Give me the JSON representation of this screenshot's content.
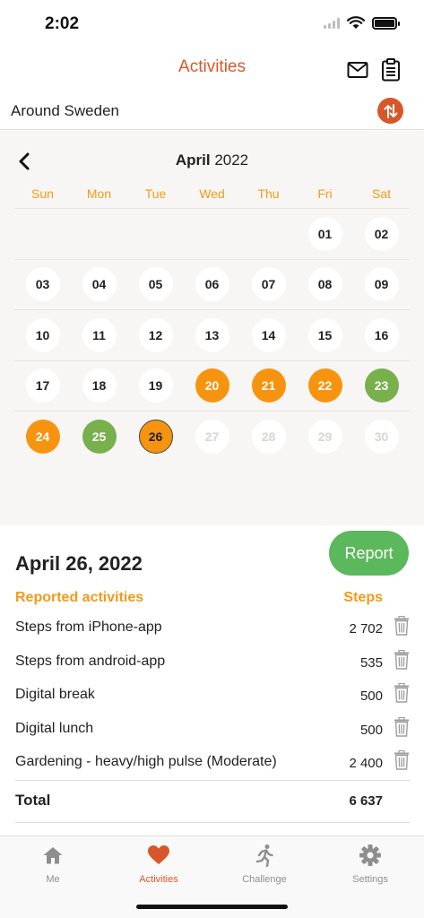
{
  "status": {
    "time": "2:02"
  },
  "nav": {
    "title": "Activities"
  },
  "team": {
    "name": "Around Sweden"
  },
  "calendar": {
    "month": "April",
    "year": "2022",
    "weekdays": [
      "Sun",
      "Mon",
      "Tue",
      "Wed",
      "Thu",
      "Fri",
      "Sat"
    ],
    "weeks": [
      [
        null,
        null,
        null,
        null,
        null,
        {
          "d": "01",
          "s": "plain"
        },
        {
          "d": "02",
          "s": "plain"
        }
      ],
      [
        {
          "d": "03",
          "s": "plain"
        },
        {
          "d": "04",
          "s": "plain"
        },
        {
          "d": "05",
          "s": "plain"
        },
        {
          "d": "06",
          "s": "plain"
        },
        {
          "d": "07",
          "s": "plain"
        },
        {
          "d": "08",
          "s": "plain"
        },
        {
          "d": "09",
          "s": "plain"
        }
      ],
      [
        {
          "d": "10",
          "s": "plain"
        },
        {
          "d": "11",
          "s": "plain"
        },
        {
          "d": "12",
          "s": "plain"
        },
        {
          "d": "13",
          "s": "plain"
        },
        {
          "d": "14",
          "s": "plain"
        },
        {
          "d": "15",
          "s": "plain"
        },
        {
          "d": "16",
          "s": "plain"
        }
      ],
      [
        {
          "d": "17",
          "s": "plain"
        },
        {
          "d": "18",
          "s": "plain"
        },
        {
          "d": "19",
          "s": "plain"
        },
        {
          "d": "20",
          "s": "orange"
        },
        {
          "d": "21",
          "s": "orange"
        },
        {
          "d": "22",
          "s": "orange"
        },
        {
          "d": "23",
          "s": "green"
        }
      ],
      [
        {
          "d": "24",
          "s": "orange"
        },
        {
          "d": "25",
          "s": "green"
        },
        {
          "d": "26",
          "s": "today"
        },
        {
          "d": "27",
          "s": "future"
        },
        {
          "d": "28",
          "s": "future"
        },
        {
          "d": "29",
          "s": "future"
        },
        {
          "d": "30",
          "s": "future"
        }
      ]
    ]
  },
  "detail": {
    "date": "April 26, 2022",
    "report_label": "Report",
    "list_header_left": "Reported activities",
    "list_header_right": "Steps",
    "activities": [
      {
        "name": "Steps from iPhone-app",
        "steps": "2 702"
      },
      {
        "name": "Steps from android-app",
        "steps": "535"
      },
      {
        "name": "Digital break",
        "steps": "500"
      },
      {
        "name": "Digital lunch",
        "steps": "500"
      },
      {
        "name": "Gardening - heavy/high pulse (Moderate)",
        "steps": "2 400"
      }
    ],
    "total_label": "Total",
    "total_value": "6 637"
  },
  "tabs": [
    {
      "label": "Me",
      "icon": "home-icon",
      "active": false
    },
    {
      "label": "Activities",
      "icon": "heart-icon",
      "active": true
    },
    {
      "label": "Challenge",
      "icon": "runner-icon",
      "active": false
    },
    {
      "label": "Settings",
      "icon": "gear-icon",
      "active": false
    }
  ],
  "colors": {
    "accent": "#d8572a",
    "orange": "#f7940f",
    "green": "#78b04c",
    "report_button": "#5cb85c"
  }
}
